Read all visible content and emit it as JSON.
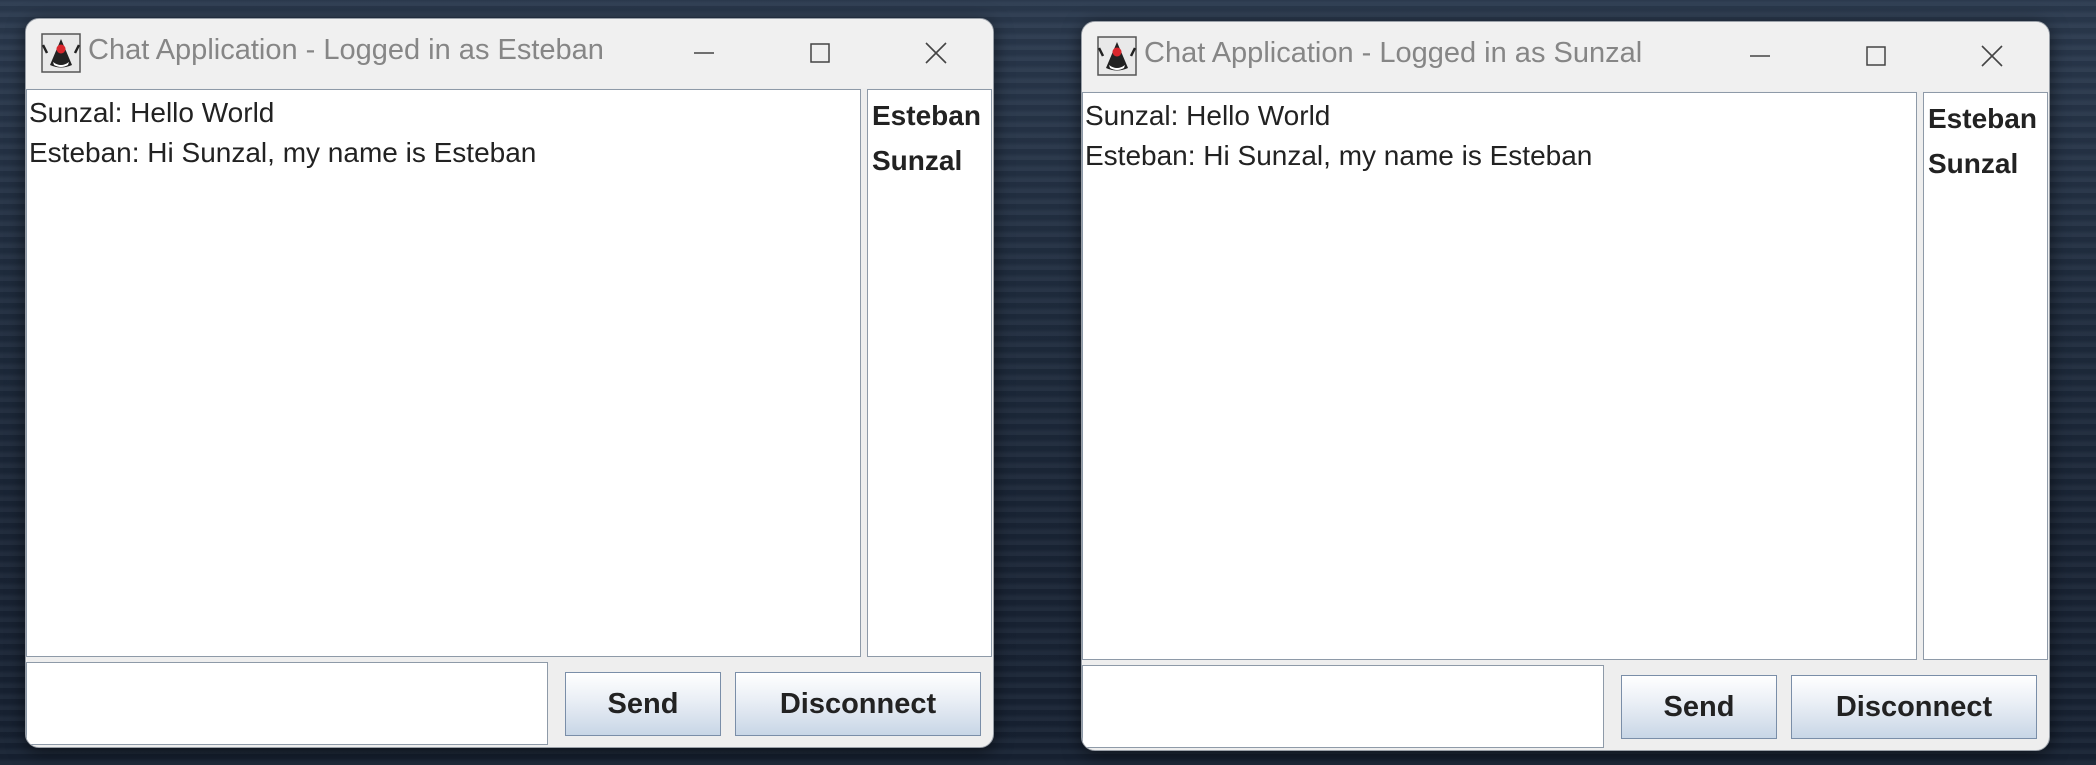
{
  "windows": [
    {
      "title": "Chat Application - Logged in as Esteban",
      "messages": [
        "Sunzal: Hello World",
        "Esteban: Hi Sunzal, my name is Esteban"
      ],
      "users": [
        "Esteban",
        "Sunzal"
      ],
      "input_value": "",
      "send_label": "Send",
      "disconnect_label": "Disconnect"
    },
    {
      "title": "Chat Application - Logged in as Sunzal",
      "messages": [
        "Sunzal: Hello World",
        "Esteban: Hi Sunzal, my name is Esteban"
      ],
      "users": [
        "Esteban",
        "Sunzal"
      ],
      "input_value": "",
      "send_label": "Send",
      "disconnect_label": "Disconnect"
    }
  ],
  "icons": {
    "app": "java-duke-icon",
    "minimize": "minimize-icon",
    "maximize": "maximize-icon",
    "close": "close-icon"
  }
}
